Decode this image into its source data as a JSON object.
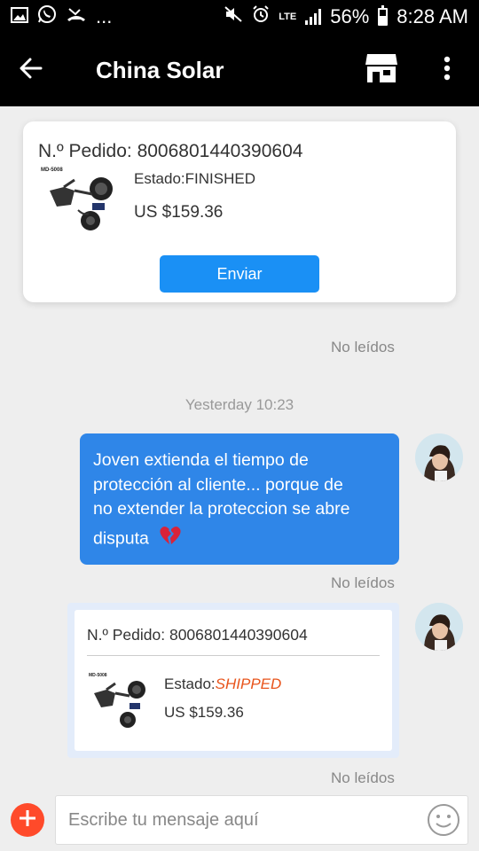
{
  "status_bar": {
    "battery": "56%",
    "battery_level": 0.56,
    "time": "8:28 AM",
    "network": "LTE",
    "dots": "..."
  },
  "app_bar": {
    "title": "China Solar",
    "back_icon": "arrow-left-icon",
    "store_icon": "store-icon",
    "more_icon": "more-vert-icon"
  },
  "order_card": {
    "order_label": "N.º Pedido: 8006801440390604",
    "product_label": "MD-5008",
    "status": "Estado:FINISHED",
    "price": "US $159.36",
    "send_label": "Enviar"
  },
  "unread_1": "No leídos",
  "timestamp": "Yesterday 10:23",
  "message": {
    "line1": "Joven extienda el tiempo de",
    "line2": "protección al cliente...  porque de",
    "line3": "no extender la proteccion se abre",
    "line4": "disputa",
    "emoji": "broken-heart-icon"
  },
  "unread_2": "No leídos",
  "shared_order": {
    "order_label": "N.º Pedido: 8006801440390604",
    "product_label": "MD-5008",
    "status_prefix": "Estado:",
    "status_value": "SHIPPED",
    "price": "US $159.36"
  },
  "unread_3": "No leídos",
  "input": {
    "placeholder": "Escribe tu mensaje aquí",
    "add_icon": "plus-icon",
    "emoji_icon": "smiley-icon"
  },
  "colors": {
    "accent": "#1a90f5",
    "bubble": "#2f86e8",
    "shipped": "#e8541b",
    "add_button": "#ff4a2a"
  }
}
